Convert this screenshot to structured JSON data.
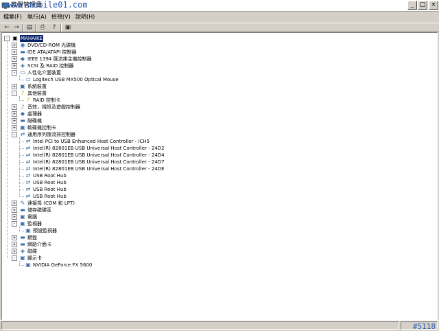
{
  "window": {
    "title": "裝置管理員",
    "watermark": "www.mobile01.com",
    "minimize": "_",
    "maximize": "□",
    "close": "×"
  },
  "menu": [
    "檔案(F)",
    "執行(A)",
    "檢視(V)",
    "說明(H)"
  ],
  "toolbar": {
    "back": "←",
    "forward": "→",
    "properties": "▤",
    "print": "⎙",
    "help": "?",
    "scan": "▣"
  },
  "tree": {
    "root": "MAHAIKE",
    "nodes": [
      {
        "label": "DVD/CD-ROM 光碟機",
        "icon": "◉",
        "expander": "+"
      },
      {
        "label": "IDE ATA/ATAPI 控制器",
        "icon": "▬",
        "expander": "+"
      },
      {
        "label": "IEEE 1394 匯流排主機控制器",
        "icon": "◆",
        "expander": "+"
      },
      {
        "label": "SCSI 及 RAID 控制器",
        "icon": "◈",
        "expander": "+"
      },
      {
        "label": "人性化介面裝置",
        "icon": "▭",
        "expander": "-"
      },
      {
        "label": "Logitech USB MX500 Optical Mouse",
        "icon": "▭",
        "child": true
      },
      {
        "label": "系統裝置",
        "icon": "▣",
        "expander": "+"
      },
      {
        "label": "其他裝置",
        "icon": "?",
        "expander": "-"
      },
      {
        "label": "RAID 控制卡",
        "icon": "?",
        "child": true
      },
      {
        "label": "音效，視訊及遊戲控制器",
        "icon": "♪",
        "expander": "+"
      },
      {
        "label": "處理器",
        "icon": "◆",
        "expander": "+"
      },
      {
        "label": "磁碟機",
        "icon": "▬",
        "expander": "+"
      },
      {
        "label": "軟碟機控制卡",
        "icon": "▣",
        "expander": "+"
      },
      {
        "label": "通用序列匯流排控制器",
        "icon": "⇄",
        "expander": "-"
      },
      {
        "label": "Intel PCI to USB Enhanced Host Controller - ICH5",
        "icon": "⇄",
        "child": true
      },
      {
        "label": "Intel(R) 82801EB USB Universal Host Controller - 24D2",
        "icon": "⇄",
        "child": true
      },
      {
        "label": "Intel(R) 82801EB USB Universal Host Controller - 24D4",
        "icon": "⇄",
        "child": true
      },
      {
        "label": "Intel(R) 82801EB USB Universal Host Controller - 24D7",
        "icon": "⇄",
        "child": true
      },
      {
        "label": "Intel(R) 82801EB USB Universal Host Controller - 24DE",
        "icon": "⇄",
        "child": true
      },
      {
        "label": "USB Root Hub",
        "icon": "⇄",
        "child": true
      },
      {
        "label": "USB Root Hub",
        "icon": "⇄",
        "child": true
      },
      {
        "label": "USB Root Hub",
        "icon": "⇄",
        "child": true
      },
      {
        "label": "USB Root Hub",
        "icon": "⇄",
        "child": true
      },
      {
        "label": "連接埠 (COM 和 LPT)",
        "icon": "✎",
        "expander": "+"
      },
      {
        "label": "儲存磁碟區",
        "icon": "▬",
        "expander": "+"
      },
      {
        "label": "電腦",
        "icon": "▣",
        "expander": "+"
      },
      {
        "label": "監視器",
        "icon": "▣",
        "expander": "-"
      },
      {
        "label": "預設監視器",
        "icon": "▣",
        "child": true
      },
      {
        "label": "鍵盤",
        "icon": "▬",
        "expander": "+"
      },
      {
        "label": "網路介面卡",
        "icon": "▬",
        "expander": "+"
      },
      {
        "label": "磁碟",
        "icon": "◈",
        "expander": "+"
      },
      {
        "label": "顯示卡",
        "icon": "▣",
        "expander": "-"
      },
      {
        "label": "NVIDIA GeForce FX 5600",
        "icon": "▣",
        "child": true
      }
    ]
  },
  "status": {
    "id": "#5118"
  }
}
